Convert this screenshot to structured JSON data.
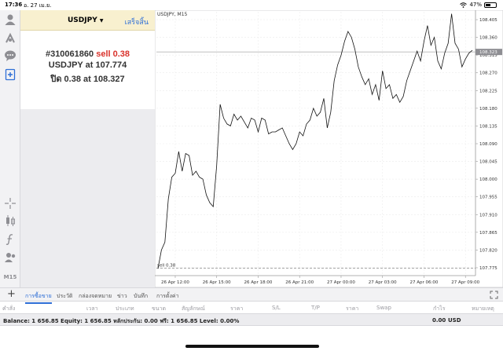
{
  "status": {
    "time": "17:36",
    "date": "อ. 27 เม.ย.",
    "battery": "47%",
    "battery_level": 0.47
  },
  "toolbar": {
    "timeframe": "M15"
  },
  "panel": {
    "symbol": "USDJPY",
    "done_label": "เสร็จสิ้น",
    "order_id": "#310061860",
    "order_type": "sell 0.38",
    "line2_prefix": "USDJPY at",
    "line2_price": "107.774",
    "line3_prefix": "ปิด 0.38 at",
    "line3_price": "108.327"
  },
  "chart": {
    "title": "USDJPY, M15",
    "current_price": "108.323",
    "order_label": "sell 0.38"
  },
  "chart_data": {
    "type": "line",
    "title": "USDJPY, M15",
    "x_ticks": [
      "26 Apr 12:00",
      "26 Apr 15:00",
      "26 Apr 18:00",
      "26 Apr 21:00",
      "27 Apr 00:00",
      "27 Apr 03:00",
      "27 Apr 06:00",
      "27 Apr 09:00"
    ],
    "y_ticks": [
      "108.405",
      "108.360",
      "108.315",
      "108.270",
      "108.225",
      "108.180",
      "108.135",
      "108.090",
      "108.045",
      "108.000",
      "107.955",
      "107.910",
      "107.865",
      "107.820",
      "107.775"
    ],
    "ylim": [
      107.755,
      108.425
    ],
    "current_price": 108.323,
    "sell_level": 107.774,
    "values": [
      107.773,
      107.82,
      107.84,
      107.95,
      108.005,
      108.015,
      108.07,
      108.02,
      108.065,
      108.06,
      108.01,
      108.02,
      108.005,
      108.0,
      107.96,
      107.94,
      107.93,
      108.035,
      108.19,
      108.155,
      108.14,
      108.135,
      108.165,
      108.15,
      108.16,
      108.145,
      108.13,
      108.155,
      108.15,
      108.12,
      108.155,
      108.15,
      108.115,
      108.12,
      108.12,
      108.125,
      108.13,
      108.11,
      108.09,
      108.075,
      108.09,
      108.12,
      108.11,
      108.14,
      108.15,
      108.18,
      108.16,
      108.17,
      108.205,
      108.13,
      108.17,
      108.25,
      108.29,
      108.315,
      108.35,
      108.375,
      108.36,
      108.33,
      108.285,
      108.26,
      108.24,
      108.255,
      108.215,
      108.24,
      108.2,
      108.275,
      108.23,
      108.24,
      108.205,
      108.215,
      108.195,
      108.21,
      108.25,
      108.275,
      108.3,
      108.325,
      108.3,
      108.35,
      108.39,
      108.34,
      108.36,
      108.3,
      108.28,
      108.32,
      108.345,
      108.42,
      108.345,
      108.33,
      108.285,
      108.305,
      108.32,
      108.327
    ]
  },
  "tabs": {
    "items": [
      {
        "label": "การซื้อขาย",
        "active": true
      },
      {
        "label": "ประวัติ",
        "active": false
      },
      {
        "label": "กล่องจดหมาย",
        "active": false
      },
      {
        "label": "ข่าว",
        "active": false
      },
      {
        "label": "บันทึก",
        "active": false
      },
      {
        "label": "การตั้งค่า",
        "active": false
      }
    ]
  },
  "columns": [
    "คำสั่ง",
    "เวลา",
    "ประเภท",
    "ขนาด",
    "สัญลักษณ์",
    "ราคา",
    "S/L",
    "T/P",
    "ราคา",
    "Swap",
    "กำไร",
    "หมายเหตุ"
  ],
  "balance": {
    "text": "Balance: 1 656.85 Equity: 1 656.85 หลักประกัน: 0.00 ฟรี: 1 656.85 Level: 0.00%",
    "profit": "0.00",
    "currency": "USD"
  },
  "colors": {
    "accent": "#2f6fd6",
    "sell": "#d9322b",
    "panel_header": "#f8f0cf",
    "price_marker": "#8e8e93"
  }
}
